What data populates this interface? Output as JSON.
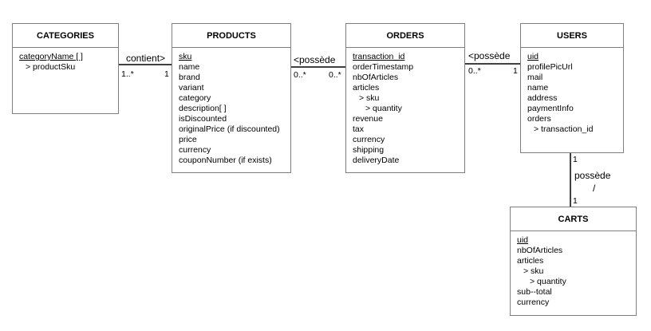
{
  "entities": {
    "categories": {
      "title": "CATEGORIES",
      "attributes": [
        {
          "text": "categoryName [ ]",
          "key": true,
          "indent": 0
        },
        {
          "text": "> productSku",
          "key": false,
          "indent": 1
        }
      ]
    },
    "products": {
      "title": "PRODUCTS",
      "attributes": [
        {
          "text": "sku",
          "key": true,
          "indent": 0
        },
        {
          "text": "name",
          "key": false,
          "indent": 0
        },
        {
          "text": "brand",
          "key": false,
          "indent": 0
        },
        {
          "text": "variant",
          "key": false,
          "indent": 0
        },
        {
          "text": "category",
          "key": false,
          "indent": 0
        },
        {
          "text": "description[ ]",
          "key": false,
          "indent": 0
        },
        {
          "text": "isDiscounted",
          "key": false,
          "indent": 0
        },
        {
          "text": "originalPrice (if discounted)",
          "key": false,
          "indent": 0
        },
        {
          "text": "price",
          "key": false,
          "indent": 0
        },
        {
          "text": "currency",
          "key": false,
          "indent": 0
        },
        {
          "text": "couponNumber (if exists)",
          "key": false,
          "indent": 0
        }
      ]
    },
    "orders": {
      "title": "ORDERS",
      "attributes": [
        {
          "text": "transaction_id",
          "key": true,
          "indent": 0
        },
        {
          "text": "orderTimestamp",
          "key": false,
          "indent": 0
        },
        {
          "text": "nbOfArticles",
          "key": false,
          "indent": 0
        },
        {
          "text": "articles",
          "key": false,
          "indent": 0
        },
        {
          "text": "> sku",
          "key": false,
          "indent": 1
        },
        {
          "text": "> quantity",
          "key": false,
          "indent": 2
        },
        {
          "text": "revenue",
          "key": false,
          "indent": 0
        },
        {
          "text": "tax",
          "key": false,
          "indent": 0
        },
        {
          "text": "currency",
          "key": false,
          "indent": 0
        },
        {
          "text": "shipping",
          "key": false,
          "indent": 0
        },
        {
          "text": "deliveryDate",
          "key": false,
          "indent": 0
        }
      ]
    },
    "users": {
      "title": "USERS",
      "attributes": [
        {
          "text": "uid",
          "key": true,
          "indent": 0
        },
        {
          "text": "profilePicUrl",
          "key": false,
          "indent": 0
        },
        {
          "text": "mail",
          "key": false,
          "indent": 0
        },
        {
          "text": "name",
          "key": false,
          "indent": 0
        },
        {
          "text": "address",
          "key": false,
          "indent": 0
        },
        {
          "text": "paymentInfo",
          "key": false,
          "indent": 0
        },
        {
          "text": "orders",
          "key": false,
          "indent": 0
        },
        {
          "text": "> transaction_id",
          "key": false,
          "indent": 1
        }
      ]
    },
    "carts": {
      "title": "CARTS",
      "attributes": [
        {
          "text": "uid",
          "key": true,
          "indent": 0
        },
        {
          "text": "nbOfArticles",
          "key": false,
          "indent": 0
        },
        {
          "text": "articles",
          "key": false,
          "indent": 0
        },
        {
          "text": "> sku",
          "key": false,
          "indent": 1
        },
        {
          "text": "> quantity",
          "key": false,
          "indent": 2
        },
        {
          "text": "sub--total",
          "key": false,
          "indent": 0
        },
        {
          "text": "currency",
          "key": false,
          "indent": 0
        }
      ]
    }
  },
  "relations": {
    "categories_products": {
      "label": "contient>",
      "mult_left": "1..*",
      "mult_right": "1"
    },
    "products_orders": {
      "label": "<possède",
      "mult_left": "0..*",
      "mult_right": "0..*"
    },
    "orders_users": {
      "label": "<possède",
      "mult_left": "0..*",
      "mult_right": "1"
    },
    "users_carts": {
      "label_line1": "possède",
      "label_line2": "/",
      "mult_top": "1",
      "mult_bottom": "1"
    }
  }
}
